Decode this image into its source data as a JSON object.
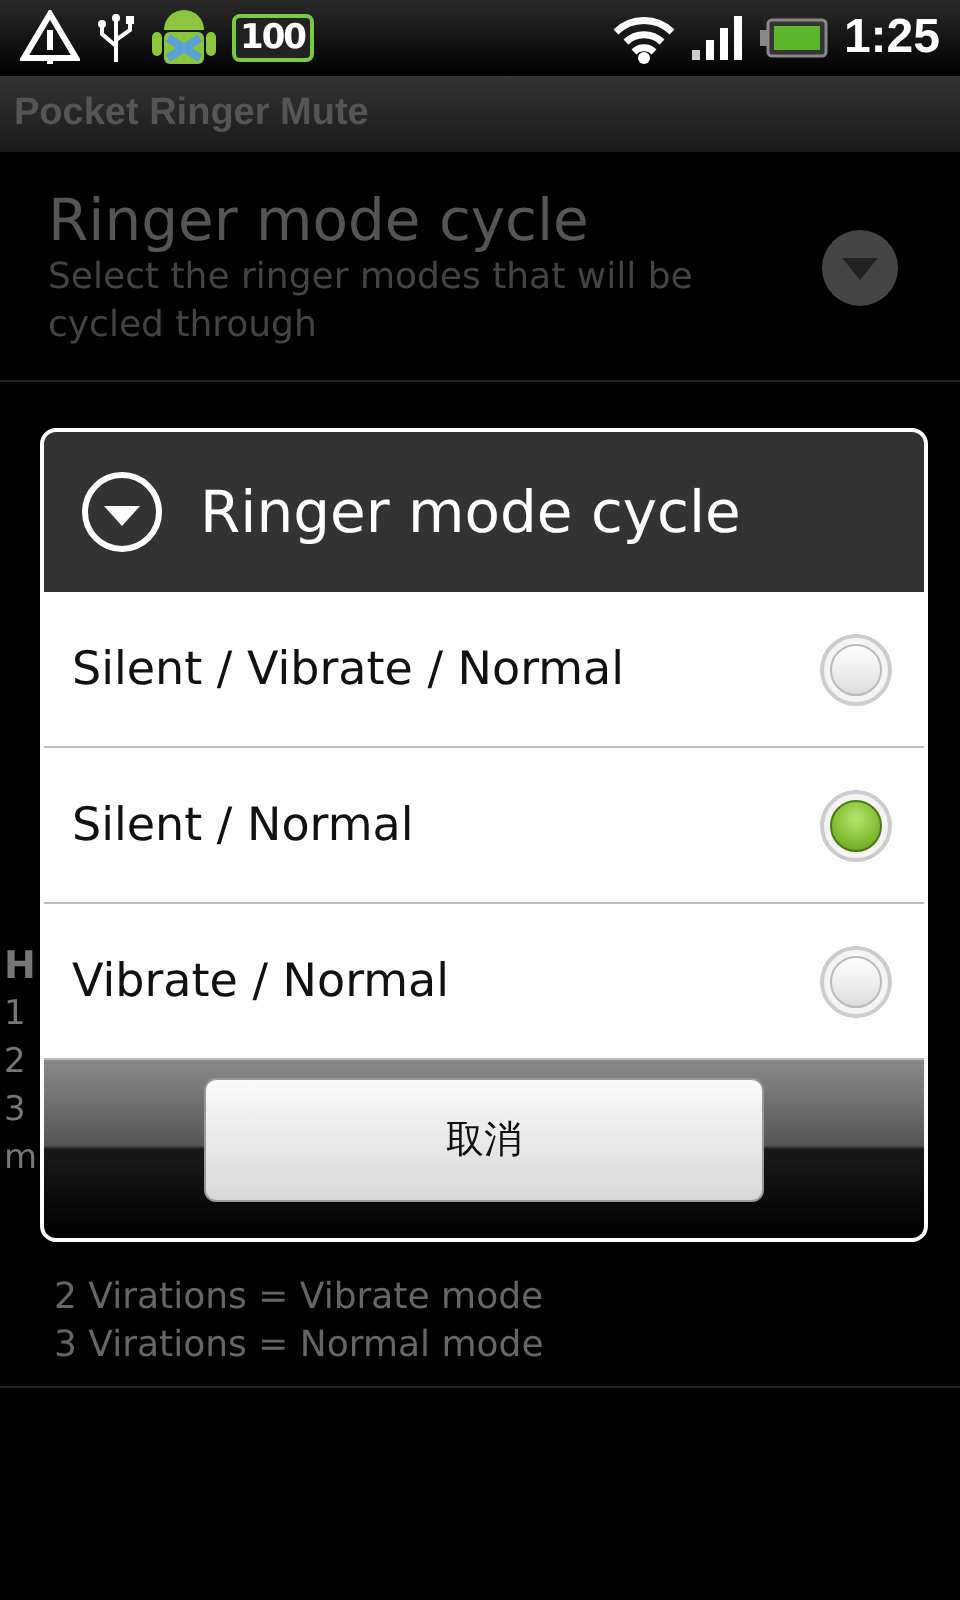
{
  "status_bar": {
    "badge": "100",
    "time": "1:25"
  },
  "app_title": "Pocket Ringer Mute",
  "preference": {
    "title": "Ringer mode cycle",
    "summary": "Select the ringer modes that will be cycled through"
  },
  "help_fragments": [
    "H",
    "1",
    "2",
    "3",
    "m"
  ],
  "help_lines": [
    "2 Virations = Vibrate mode",
    "3 Virations = Normal mode"
  ],
  "dialog": {
    "title": "Ringer mode cycle",
    "options": [
      {
        "label": "Silent / Vibrate / Normal",
        "selected": false
      },
      {
        "label": "Silent / Normal",
        "selected": true
      },
      {
        "label": "Vibrate / Normal",
        "selected": false
      }
    ],
    "buttons": [
      "取消"
    ]
  }
}
